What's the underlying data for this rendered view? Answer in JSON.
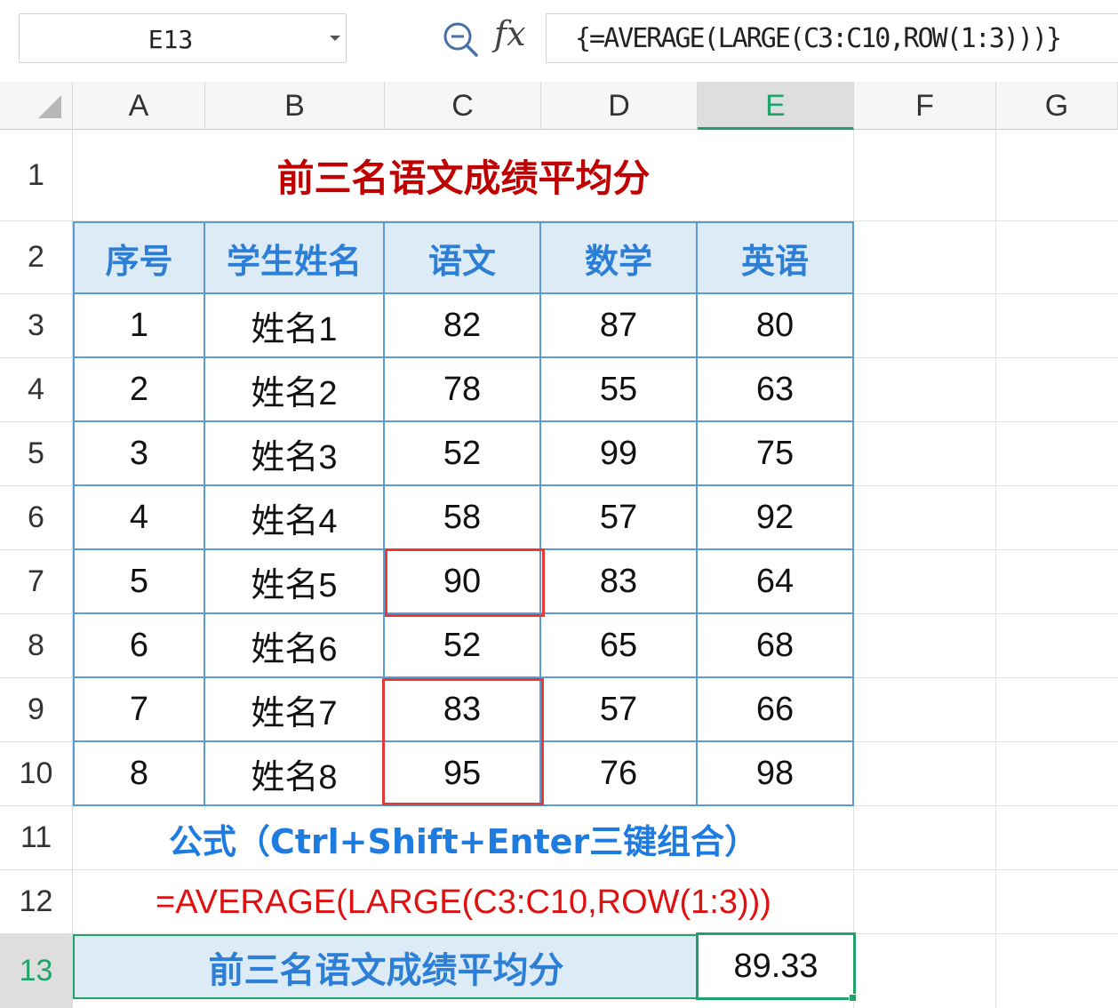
{
  "formula_bar": {
    "name_box": "E13",
    "zoom_icon": "zoom-magnifier-icon",
    "fx_label": "fx",
    "formula": "{=AVERAGE(LARGE(C3:C10,ROW(1:3)))}"
  },
  "columns": [
    "A",
    "B",
    "C",
    "D",
    "E",
    "F",
    "G"
  ],
  "rows": [
    "1",
    "2",
    "3",
    "4",
    "5",
    "6",
    "7",
    "8",
    "9",
    "10",
    "11",
    "12",
    "13"
  ],
  "selected_column": "E",
  "selected_row": "13",
  "sheet": {
    "title": "前三名语文成绩平均分",
    "headers": [
      "序号",
      "学生姓名",
      "语文",
      "数学",
      "英语"
    ],
    "data_rows": [
      [
        "1",
        "姓名1",
        "82",
        "87",
        "80"
      ],
      [
        "2",
        "姓名2",
        "78",
        "55",
        "63"
      ],
      [
        "3",
        "姓名3",
        "52",
        "99",
        "75"
      ],
      [
        "4",
        "姓名4",
        "58",
        "57",
        "92"
      ],
      [
        "5",
        "姓名5",
        "90",
        "83",
        "64"
      ],
      [
        "6",
        "姓名6",
        "52",
        "65",
        "68"
      ],
      [
        "7",
        "姓名7",
        "83",
        "57",
        "66"
      ],
      [
        "8",
        "姓名8",
        "95",
        "76",
        "98"
      ]
    ],
    "note": "公式（Ctrl+Shift+Enter三键组合）",
    "formula_text": "=AVERAGE(LARGE(C3:C10,ROW(1:3)))",
    "result_label": "前三名语文成绩平均分",
    "result_value": "89.33"
  },
  "colors": {
    "title": "#c00000",
    "header_fill": "#ddebf7",
    "header_text": "#2c7fd4",
    "table_border": "#5b9bd5",
    "highlight_box": "#e53935",
    "selection": "#1fa36a"
  }
}
